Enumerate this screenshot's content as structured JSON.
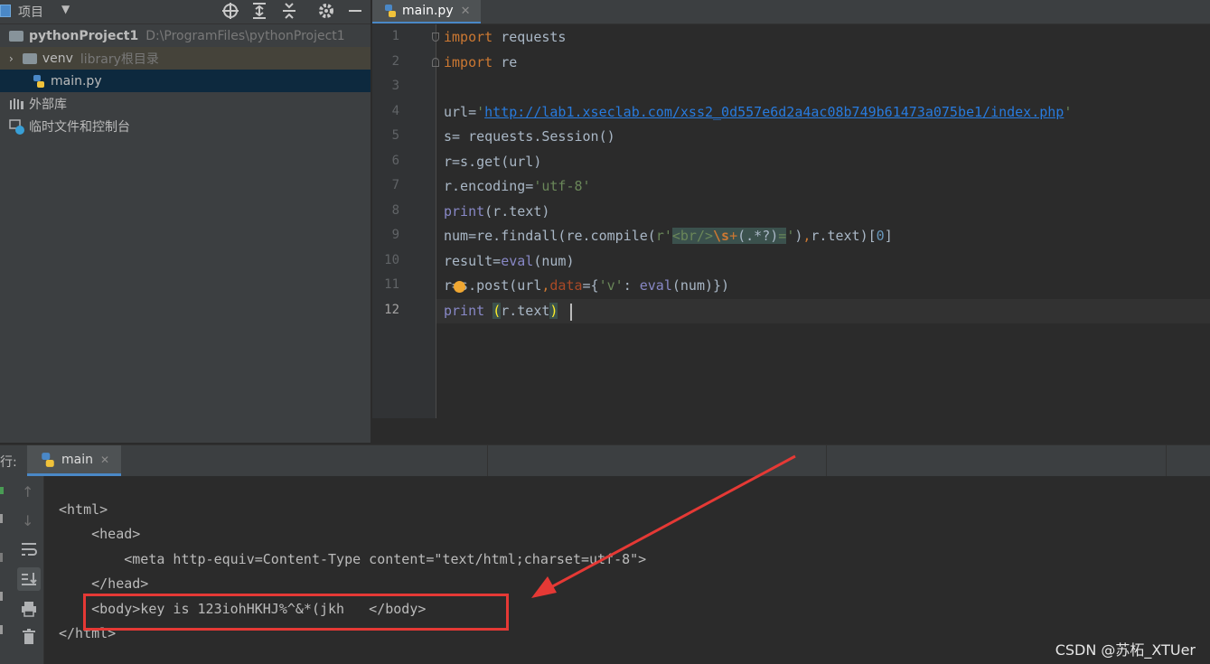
{
  "project_panel": {
    "title": "项目",
    "root": {
      "name": "pythonProject1",
      "path": "D:\\ProgramFiles\\pythonProject1"
    },
    "items": [
      {
        "name": "venv",
        "hint": "library根目录"
      },
      {
        "name": "main.py"
      },
      {
        "name": "外部库"
      },
      {
        "name": "临时文件和控制台"
      }
    ]
  },
  "editor": {
    "tab": "main.py",
    "line_numbers": [
      "1",
      "2",
      "3",
      "4",
      "5",
      "6",
      "7",
      "8",
      "9",
      "10",
      "11",
      "12"
    ]
  },
  "run_panel": {
    "label": "行:",
    "tab": "main",
    "output": [
      "<html>",
      "    <head>",
      "        <meta http-equiv=Content-Type content=\"text/html;charset=utf-8\">",
      "    </head>",
      "    <body>key is 123iohHKHJ%^&*(jkh   </body>",
      "</html>"
    ]
  },
  "watermark": "CSDN @苏柘_XTUer",
  "colors": {
    "annotation": "#e53935",
    "keyword": "#cc7832",
    "string": "#6a8759",
    "builtin": "#8888c6"
  }
}
